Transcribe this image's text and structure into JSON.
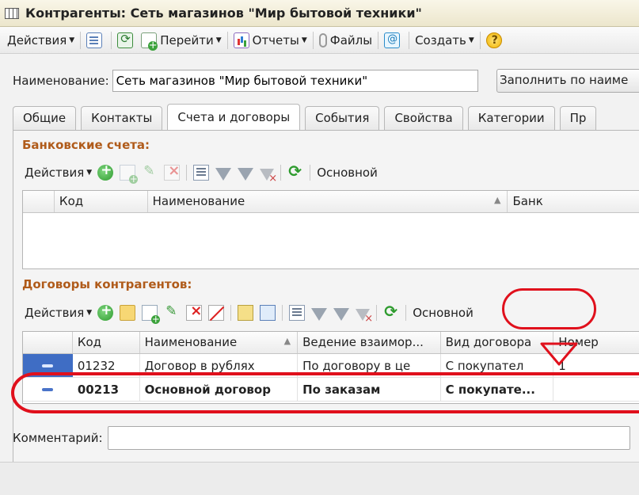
{
  "window": {
    "title": "Контрагенты: Сеть магазинов \"Мир бытовой техники\""
  },
  "toolbar": {
    "actions": "Действия",
    "goto": "Перейти",
    "reports": "Отчеты",
    "files": "Файлы",
    "create": "Создать"
  },
  "form": {
    "name_label": "Наименование:",
    "name_value": "Сеть магазинов \"Мир бытовой техники\"",
    "fill_button": "Заполнить по наиме",
    "comment_label": "Комментарий:"
  },
  "tabs": [
    "Общие",
    "Контакты",
    "Счета и договоры",
    "События",
    "Свойства",
    "Категории",
    "Пр"
  ],
  "bank_accounts": {
    "title": "Банковские счета:",
    "actions": "Действия",
    "main_button": "Основной",
    "columns": [
      "Код",
      "Наименование",
      "Банк"
    ]
  },
  "contracts": {
    "title": "Договоры контрагентов:",
    "actions": "Действия",
    "main_button": "Основной",
    "columns": [
      "Код",
      "Наименование",
      "Ведение взаимор...",
      "Вид договора",
      "Номер"
    ],
    "rows": [
      {
        "code": "01232",
        "name": "Договор в рублях",
        "mode": "По договору в це",
        "kind": "С покупател",
        "number": "1"
      },
      {
        "code": "00213",
        "name": "Основной договор",
        "mode": "По заказам",
        "kind": "С покупате...",
        "number": ""
      }
    ]
  },
  "colors": {
    "annotation": "#e0101c",
    "section_title": "#b05b1a",
    "selection": "#3f6dc4"
  }
}
